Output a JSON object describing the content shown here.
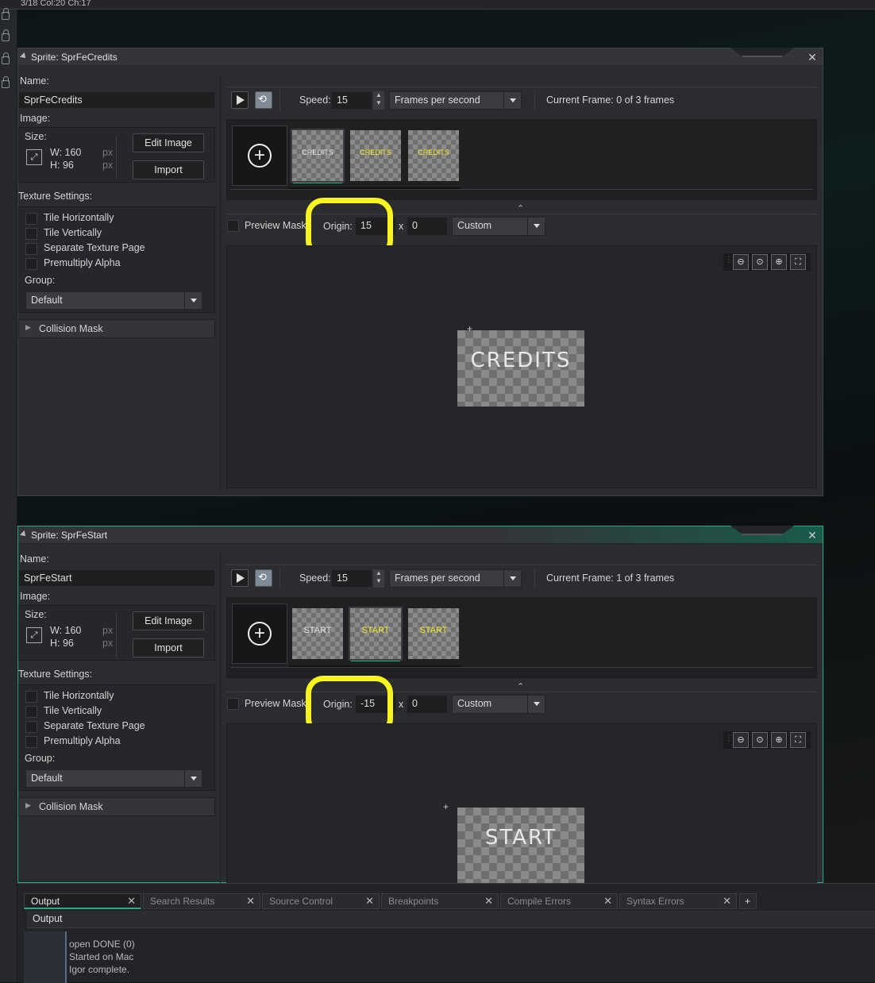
{
  "status_bar": {
    "text": "3/18 Col:20 Ch:17"
  },
  "windows": [
    {
      "title": "Sprite: SprFeCredits",
      "name_label": "Name:",
      "name_value": "SprFeCredits",
      "image_label": "Image:",
      "size_label": "Size:",
      "width": "W: 160",
      "height": "H: 96",
      "px": "px",
      "edit_image": "Edit Image",
      "import": "Import",
      "texture_settings_label": "Texture Settings:",
      "tile_h": "Tile Horizontally",
      "tile_v": "Tile Vertically",
      "separate_page": "Separate Texture Page",
      "premultiply": "Premultiply Alpha",
      "group_label": "Group:",
      "group_value": "Default",
      "collision_mask": "Collision Mask",
      "speed_label": "Speed:",
      "speed_value": "15",
      "speed_unit": "Frames per second",
      "current_frame": "Current Frame: 0 of 3 frames",
      "frame_word": "CREDITS",
      "preview_mask": "Preview Mask",
      "origin_label": "Origin:",
      "origin_x": "15",
      "origin_sep": "x",
      "origin_y": "0",
      "origin_preset": "Custom",
      "preview_text": "CREDITS",
      "selected_frame": 0
    },
    {
      "title": "Sprite: SprFeStart",
      "name_label": "Name:",
      "name_value": "SprFeStart",
      "image_label": "Image:",
      "size_label": "Size:",
      "width": "W: 160",
      "height": "H: 96",
      "px": "px",
      "edit_image": "Edit Image",
      "import": "Import",
      "texture_settings_label": "Texture Settings:",
      "tile_h": "Tile Horizontally",
      "tile_v": "Tile Vertically",
      "separate_page": "Separate Texture Page",
      "premultiply": "Premultiply Alpha",
      "group_label": "Group:",
      "group_value": "Default",
      "collision_mask": "Collision Mask",
      "speed_label": "Speed:",
      "speed_value": "15",
      "speed_unit": "Frames per second",
      "current_frame": "Current Frame: 1 of 3 frames",
      "frame_word": "START",
      "preview_mask": "Preview Mask",
      "origin_label": "Origin:",
      "origin_x": "-15",
      "origin_sep": "x",
      "origin_y": "0",
      "origin_preset": "Custom",
      "preview_text": "START",
      "selected_frame": 1
    }
  ],
  "output": {
    "tabs": [
      "Output",
      "Search Results",
      "Source Control",
      "Breakpoints",
      "Compile Errors",
      "Syntax Errors"
    ],
    "add_tab": "+",
    "header": "Output",
    "lines": [
      "open DONE (0)",
      "Started on Mac",
      "Igor complete."
    ]
  },
  "colors": {
    "accent": "#2aa883",
    "highlight": "#f7f421"
  }
}
